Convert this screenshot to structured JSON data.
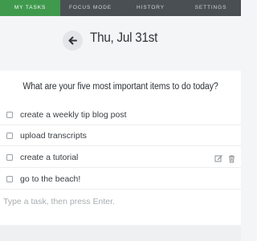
{
  "nav": {
    "tabs": [
      {
        "label": "MY TASKS",
        "active": true
      },
      {
        "label": "FOCUS MODE",
        "active": false
      },
      {
        "label": "HISTORY",
        "active": false
      },
      {
        "label": "SETTINGS",
        "active": false
      }
    ]
  },
  "header": {
    "date": "Thu, Jul 31st",
    "back_icon": "arrow-left-icon"
  },
  "main": {
    "question": "What are your five most important items to do today?",
    "tasks": [
      {
        "label": "create a weekly tip blog post",
        "checked": false
      },
      {
        "label": "upload transcripts",
        "checked": false
      },
      {
        "label": "create a tutorial",
        "checked": false,
        "actions": [
          "edit-icon",
          "trash-icon"
        ]
      },
      {
        "label": "go to the beach!",
        "checked": false
      }
    ],
    "input": {
      "placeholder": "Type a task, then press Enter.",
      "value": ""
    }
  },
  "colors": {
    "nav_bg": "#4a4f54",
    "nav_active": "#3f9a4d",
    "page_bg": "#f4f5f6"
  }
}
